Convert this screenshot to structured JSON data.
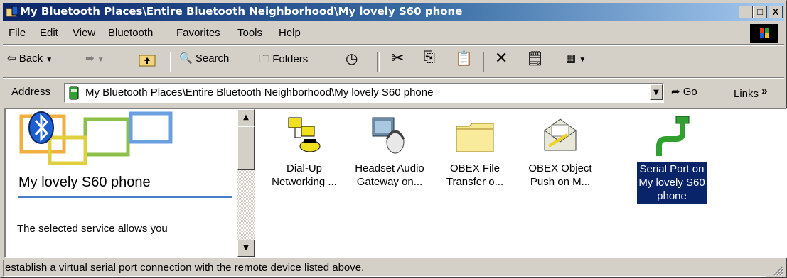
{
  "window": {
    "title": "My Bluetooth Places\\Entire Bluetooth Neighborhood\\My lovely S60 phone",
    "minimize": "_",
    "maximize": "□",
    "close": "X"
  },
  "menu": [
    "File",
    "Edit",
    "View",
    "Bluetooth",
    "Favorites",
    "Tools",
    "Help"
  ],
  "toolbar": {
    "back_label": "Back",
    "search_label": "Search",
    "folders_label": "Folders"
  },
  "address": {
    "label": "Address",
    "value": "My Bluetooth Places\\Entire Bluetooth Neighborhood\\My lovely S60 phone",
    "go_label": "Go",
    "links_label": "Links",
    "links_chevron": "»"
  },
  "left_pane": {
    "title": "My lovely S60 phone",
    "description": "The selected service allows you"
  },
  "services": [
    {
      "line1": "Dial-Up",
      "line2": "Networking ...",
      "line3": ""
    },
    {
      "line1": "Headset Audio",
      "line2": "Gateway on...",
      "line3": ""
    },
    {
      "line1": "OBEX File",
      "line2": "Transfer o...",
      "line3": ""
    },
    {
      "line1": "OBEX Object",
      "line2": "Push on M...",
      "line3": ""
    },
    {
      "line1": "Serial Port on",
      "line2": "My lovely S60",
      "line3": "phone"
    }
  ],
  "status": "establish a virtual serial port connection with the remote device listed above.",
  "colors": {
    "titlebar_start": "#0a246a",
    "titlebar_end": "#a6caf0",
    "selection": "#0a246a"
  }
}
